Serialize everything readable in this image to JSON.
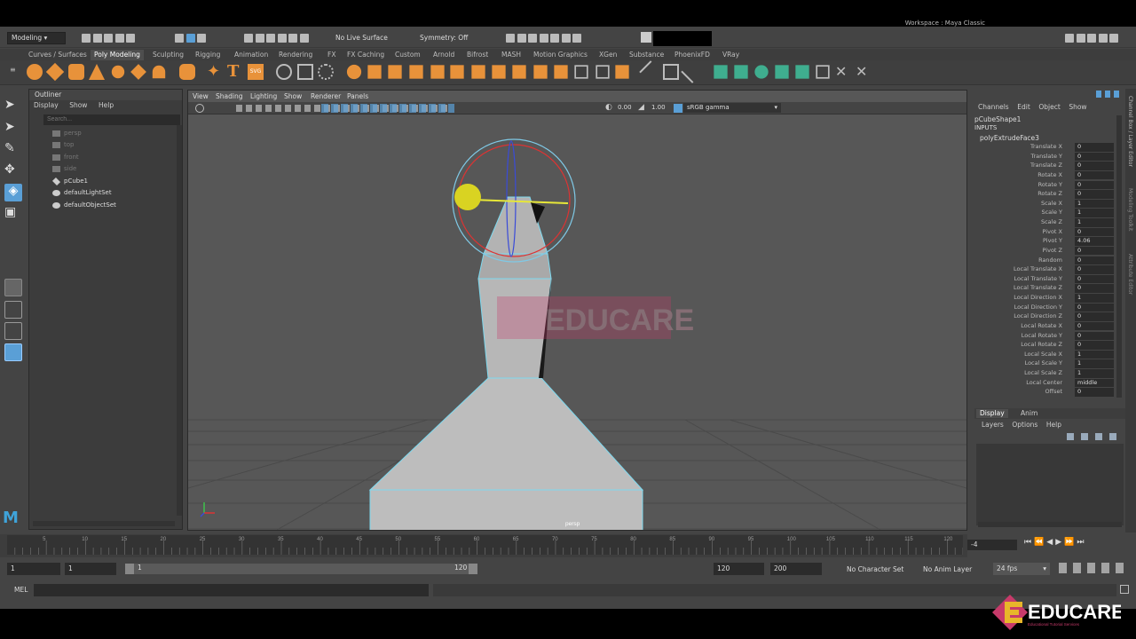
{
  "workspace": {
    "label": "Workspace :",
    "value": "Maya Classic"
  },
  "status_line": {
    "menu_set": "Modeling",
    "live_surface": "No Live Surface",
    "symmetry": "Symmetry: Off"
  },
  "shelf_tabs": [
    "Curves / Surfaces",
    "Poly Modeling",
    "Sculpting",
    "Rigging",
    "Animation",
    "Rendering",
    "FX",
    "FX Caching",
    "Custom",
    "Arnold",
    "Bifrost",
    "MASH",
    "Motion Graphics",
    "XGen",
    "Substance",
    "PhoenixFD",
    "VRay"
  ],
  "active_shelf_tab": "Poly Modeling",
  "shelf_text_icons": {
    "type": "T",
    "svg": "SVG"
  },
  "outliner": {
    "title": "Outliner",
    "menu": [
      "Display",
      "Show",
      "Help"
    ],
    "search_placeholder": "Search...",
    "items": [
      {
        "label": "persp",
        "dim": true
      },
      {
        "label": "top",
        "dim": true
      },
      {
        "label": "front",
        "dim": true
      },
      {
        "label": "side",
        "dim": true
      },
      {
        "label": "pCube1",
        "dim": false
      },
      {
        "label": "defaultLightSet",
        "dim": false
      },
      {
        "label": "defaultObjectSet",
        "dim": false
      }
    ]
  },
  "viewport": {
    "menu": [
      "View",
      "Shading",
      "Lighting",
      "Show",
      "Renderer",
      "Panels"
    ],
    "field_a": "0.00",
    "field_b": "1.00",
    "color_space": "sRGB gamma",
    "camera_label": "persp"
  },
  "channel_box": {
    "menu": [
      "Channels",
      "Edit",
      "Object",
      "Show"
    ],
    "shape": "pCubeShape1",
    "inputs_label": "INPUTS",
    "node": "polyExtrudeFace3",
    "attributes": [
      [
        "Translate X",
        "0"
      ],
      [
        "Translate Y",
        "0"
      ],
      [
        "Translate Z",
        "0"
      ],
      [
        "Rotate X",
        "0"
      ],
      [
        "Rotate Y",
        "0"
      ],
      [
        "Rotate Z",
        "0"
      ],
      [
        "Scale X",
        "1"
      ],
      [
        "Scale Y",
        "1"
      ],
      [
        "Scale Z",
        "1"
      ],
      [
        "Pivot X",
        "0"
      ],
      [
        "Pivot Y",
        "4.06"
      ],
      [
        "Pivot Z",
        "0"
      ],
      [
        "Random",
        "0"
      ],
      [
        "Local Translate X",
        "0"
      ],
      [
        "Local Translate Y",
        "0"
      ],
      [
        "Local Translate Z",
        "0"
      ],
      [
        "Local Direction X",
        "1"
      ],
      [
        "Local Direction Y",
        "0"
      ],
      [
        "Local Direction Z",
        "0"
      ],
      [
        "Local Rotate X",
        "0"
      ],
      [
        "Local Rotate Y",
        "0"
      ],
      [
        "Local Rotate Z",
        "0"
      ],
      [
        "Local Scale X",
        "1"
      ],
      [
        "Local Scale Y",
        "1"
      ],
      [
        "Local Scale Z",
        "1"
      ],
      [
        "Local Center",
        "middle"
      ],
      [
        "Offset",
        "0"
      ]
    ]
  },
  "side_tabs": [
    "Channel Box / Layer Editor",
    "Modeling Toolkit",
    "Attribute Editor"
  ],
  "layer_editor": {
    "tabs": [
      "Display",
      "Anim"
    ],
    "menu": [
      "Layers",
      "Options",
      "Help"
    ]
  },
  "timeline": {
    "ticks": [
      "5",
      "10",
      "15",
      "20",
      "25",
      "30",
      "35",
      "40",
      "45",
      "50",
      "55",
      "60",
      "65",
      "70",
      "75",
      "80",
      "85",
      "90",
      "95",
      "100",
      "105",
      "110",
      "115",
      "120"
    ],
    "current_frame": "-4"
  },
  "range": {
    "start": "1",
    "anim_start": "1",
    "slider_start": "1",
    "slider_end": "120",
    "end": "120",
    "anim_end": "200",
    "character_set": "No Character Set",
    "anim_layer": "No Anim Layer",
    "fps": "24 fps"
  },
  "command_line": {
    "label": "MEL"
  },
  "watermark": {
    "text": "EDUCARE",
    "tagline": "Educational Tutorial Services"
  },
  "colors": {
    "accent_blue": "#5a9fd6",
    "shelf_orange": "#e8923a",
    "shelf_green": "#3fae8f",
    "selection_cyan": "#5fd8f0"
  }
}
